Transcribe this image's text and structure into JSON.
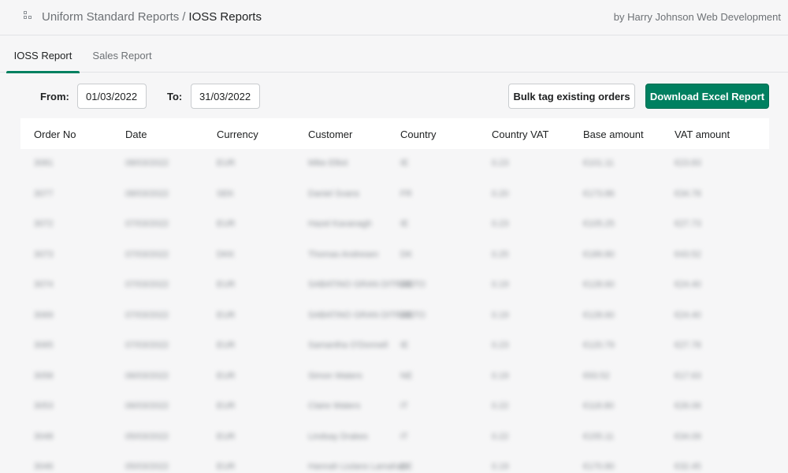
{
  "header": {
    "app_name": "Uniform Standard Reports",
    "separator": "/",
    "page_name": "IOSS Reports",
    "byline": "by Harry Johnson Web Development"
  },
  "tabs": [
    {
      "label": "IOSS Report",
      "active": true
    },
    {
      "label": "Sales Report",
      "active": false
    }
  ],
  "filters": {
    "from_label": "From:",
    "from_value": "01/03/2022",
    "to_label": "To:",
    "to_value": "31/03/2022"
  },
  "actions": {
    "bulk_tag_label": "Bulk tag existing orders",
    "download_label": "Download Excel Report"
  },
  "table": {
    "columns": [
      "Order No",
      "Date",
      "Currency",
      "Customer",
      "Country",
      "Country VAT",
      "Base amount",
      "VAT amount"
    ],
    "rows": [
      [
        "3081",
        "08/03/2022",
        "EUR",
        "Mike Elliot",
        "IE",
        "0.23",
        "€101.11",
        "€23.83"
      ],
      [
        "3077",
        "08/03/2022",
        "SEK",
        "Daniel Svans",
        "FR",
        "0.20",
        "€173.86",
        "€34.78"
      ],
      [
        "3072",
        "07/03/2022",
        "EUR",
        "Hazel Kavanagh",
        "IE",
        "0.23",
        "€105.25",
        "€27.73"
      ],
      [
        "3073",
        "07/03/2022",
        "DKK",
        "Thomas Andresen",
        "DK",
        "0.25",
        "€189.80",
        "€43.52"
      ],
      [
        "3074",
        "07/03/2022",
        "EUR",
        "SABATINO GRAN DITRANTO",
        "DE",
        "0.19",
        "€128.60",
        "€24.40"
      ],
      [
        "3069",
        "07/03/2022",
        "EUR",
        "SABATINO GRAN DITRANTO",
        "DE",
        "0.19",
        "€128.60",
        "€24.40"
      ],
      [
        "3065",
        "07/03/2022",
        "EUR",
        "Samantha O'Donnell",
        "IE",
        "0.23",
        "€120.79",
        "€27.78"
      ],
      [
        "3058",
        "06/03/2022",
        "EUR",
        "Simon Waters",
        "NE",
        "0.19",
        "€93.52",
        "€17.63"
      ],
      [
        "3053",
        "06/03/2022",
        "EUR",
        "Claire Waters",
        "IT",
        "0.22",
        "€118.80",
        "€26.06"
      ],
      [
        "3048",
        "05/03/2022",
        "EUR",
        "Lindsay Drakes",
        "IT",
        "0.22",
        "€155.11",
        "€34.09"
      ],
      [
        "3046",
        "05/03/2022",
        "EUR",
        "Hannah Liulans Lamahan",
        "DE",
        "0.19",
        "€170.80",
        "€32.45"
      ]
    ]
  }
}
